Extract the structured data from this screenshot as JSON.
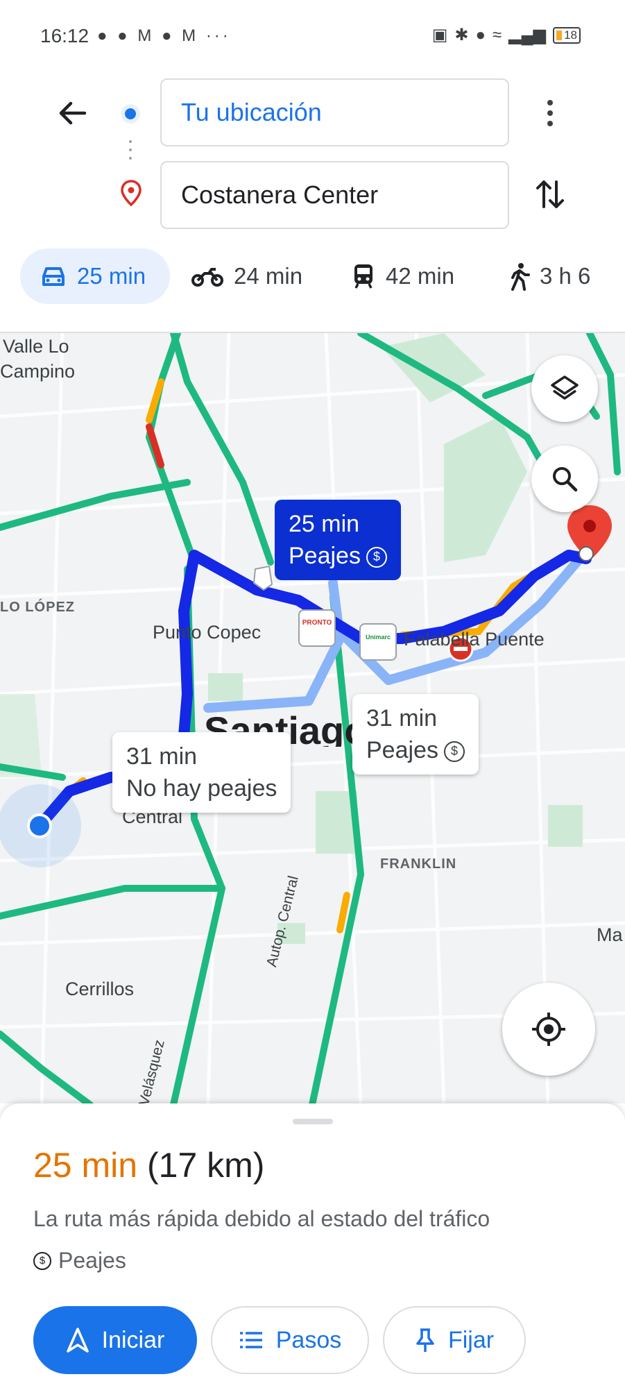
{
  "status_bar": {
    "time": "16:12",
    "left_icons": "● ● M ● M ···",
    "battery": "18"
  },
  "directions": {
    "origin": "Tu ubicación",
    "destination": "Costanera Center"
  },
  "modes": [
    {
      "icon": "car-icon",
      "label": "25 min",
      "selected": true
    },
    {
      "icon": "motorcycle-icon",
      "label": "24 min"
    },
    {
      "icon": "transit-icon",
      "label": "42 min"
    },
    {
      "icon": "walk-icon",
      "label": "3 h 6"
    }
  ],
  "map": {
    "labels": {
      "valle": "Valle Lo",
      "campino": "Campino",
      "lopez": "LO LÓPEZ",
      "punto_copec": "Punto Copec",
      "falabella": "Falabella Puente",
      "santiago": "Santiago",
      "central": "Central",
      "franklin": "FRANKLIN",
      "ma": "Ma",
      "cerrillos": "Cerrillos",
      "autop": "Autop. Central",
      "velasquez": "Velásquez"
    },
    "pois": {
      "pronto": "PRONTO",
      "unimarc": "Unimarc"
    },
    "callouts": {
      "primary": {
        "time": "25 min",
        "note": "Peajes"
      },
      "alt1": {
        "time": "31 min",
        "note": "No hay peajes"
      },
      "alt2": {
        "time": "31 min",
        "note": "Peajes"
      }
    },
    "colors": {
      "selected_route": "#1428e6",
      "alt_route": "#8ab4f8",
      "traffic_free": "#1eb980",
      "traffic_slow": "#f9ab00",
      "traffic_heavy": "#d93025"
    }
  },
  "sheet": {
    "time": "25 min",
    "distance": "(17 km)",
    "description": "La ruta más rápida debido al estado del tráfico",
    "toll": "Peajes",
    "buttons": {
      "start": "Iniciar",
      "steps": "Pasos",
      "pin": "Fijar"
    }
  }
}
